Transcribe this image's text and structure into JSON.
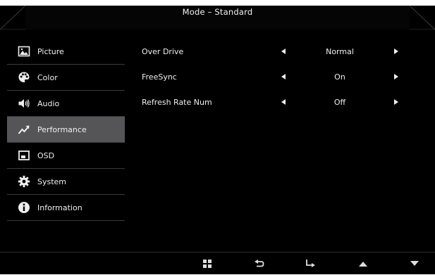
{
  "header": {
    "title": "Mode – Standard"
  },
  "sidebar": {
    "items": [
      {
        "label": "Picture",
        "icon": "picture-icon"
      },
      {
        "label": "Color",
        "icon": "palette-icon"
      },
      {
        "label": "Audio",
        "icon": "speaker-icon"
      },
      {
        "label": "Performance",
        "icon": "performance-icon"
      },
      {
        "label": "OSD",
        "icon": "osd-icon"
      },
      {
        "label": "System",
        "icon": "gear-icon"
      },
      {
        "label": "Information",
        "icon": "info-icon"
      }
    ],
    "active_index": 3
  },
  "settings": {
    "rows": [
      {
        "label": "Over Drive",
        "value": "Normal"
      },
      {
        "label": "FreeSync",
        "value": "On"
      },
      {
        "label": "Refresh Rate Num",
        "value": "Off"
      }
    ]
  },
  "bottom_bar": {
    "buttons": [
      "menu-grid-icon",
      "back-icon",
      "enter-icon",
      "up-arrow-icon",
      "down-arrow-icon"
    ]
  },
  "colors": {
    "background": "#000000",
    "text": "#f0f0f0",
    "active": "#555558",
    "divider": "#3a3a3a"
  }
}
